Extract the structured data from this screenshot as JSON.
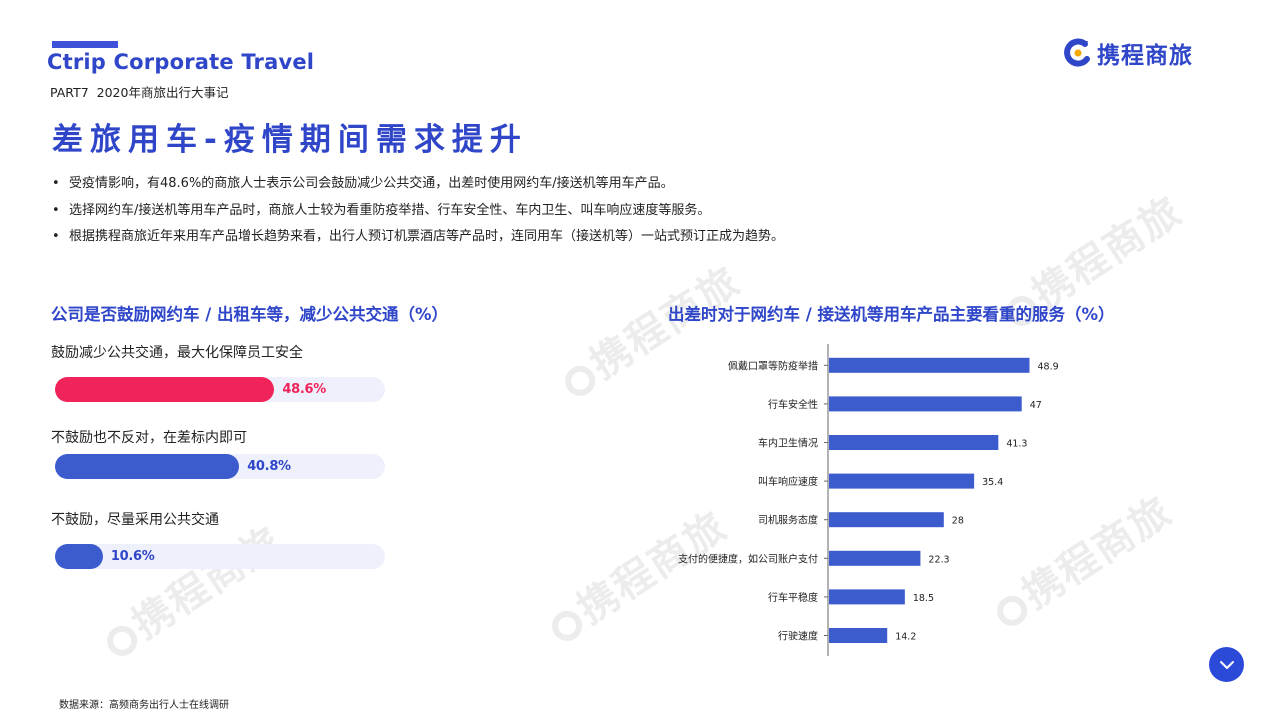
{
  "header": {
    "brand": "Ctrip Corporate Travel",
    "part": "PART7",
    "part_subtitle": "2020年商旅出行大事记",
    "title": "差旅用车-疫情期间需求提升",
    "logo_text": "携程商旅",
    "accent_color": "#2f46c9"
  },
  "bullets": [
    "受疫情影响，有48.6%的商旅人士表示公司会鼓励减少公共交通，出差时使用网约车/接送机等用车产品。",
    "选择网约车/接送机等用车产品时，商旅人士较为看重防疫举措、行车安全性、车内卫生、叫车响应速度等服务。",
    "根据携程商旅近年来用车产品增长趋势来看，出行人预订机票酒店等产品时，连同用车（接送机等）一站式预订正成为趋势。"
  ],
  "watermark_text": "携程商旅",
  "left_section": {
    "title": "公司是否鼓励网约车 / 出租车等，减少公共交通（%）"
  },
  "right_section": {
    "title": "出差时对于网约车 / 接送机等用车产品主要看重的服务（%）"
  },
  "chart_data": [
    {
      "type": "bar",
      "orientation": "horizontal",
      "title": "公司是否鼓励网约车 / 出租车等，减少公共交通（%）",
      "categories": [
        "鼓励减少公共交通，最大化保障员工安全",
        "不鼓励也不反对，在差标内即可",
        "不鼓励，尽量采用公共交通"
      ],
      "values": [
        48.6,
        40.8,
        10.6
      ],
      "value_labels": [
        "48.6%",
        "40.8%",
        "10.6%"
      ],
      "colors": [
        "#f0245a",
        "#3c5cce",
        "#3c5cce"
      ]
    },
    {
      "type": "bar",
      "orientation": "horizontal",
      "title": "出差时对于网约车 / 接送机等用车产品主要看重的服务（%）",
      "categories": [
        "佩戴口罩等防疫举措",
        "行车安全性",
        "车内卫生情况",
        "叫车响应速度",
        "司机服务态度",
        "支付的便捷度，如公司账户支付",
        "行车平稳度",
        "行驶速度"
      ],
      "values": [
        48.9,
        47,
        41.3,
        35.4,
        28,
        22.3,
        18.5,
        14.2
      ],
      "value_labels": [
        "48.9",
        "47",
        "41.3",
        "35.4",
        "28",
        "22.3",
        "18.5",
        "14.2"
      ],
      "color": "#3c5cce"
    }
  ],
  "footer": {
    "source": "数据来源：高频商务出行人士在线调研"
  },
  "nav": {
    "down_icon": "chevron-down-icon",
    "button_color": "#2c4ad8"
  }
}
